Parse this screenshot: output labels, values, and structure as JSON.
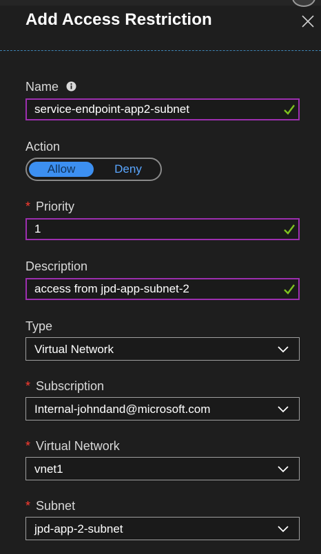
{
  "header": {
    "title": "Add Access Restriction"
  },
  "fields": {
    "name": {
      "label": "Name",
      "value": "service-endpoint-app2-subnet"
    },
    "action": {
      "label": "Action",
      "options": [
        "Allow",
        "Deny"
      ],
      "selected": "Allow"
    },
    "priority": {
      "label": "Priority",
      "required": true,
      "value": "1"
    },
    "description": {
      "label": "Description",
      "value": "access from jpd-app-subnet-2"
    },
    "type": {
      "label": "Type",
      "value": "Virtual Network"
    },
    "subscription": {
      "label": "Subscription",
      "required": true,
      "value": "Internal-johndand@microsoft.com"
    },
    "virtual_network": {
      "label": "Virtual Network",
      "required": true,
      "value": "vnet1"
    },
    "subnet": {
      "label": "Subnet",
      "required": true,
      "value": "jpd-app-2-subnet"
    }
  },
  "required_marker": "*",
  "icons": {
    "close": "close-icon",
    "info": "info-icon",
    "valid": "check-icon",
    "dropdown": "chevron-down-icon"
  },
  "colors": {
    "background": "#1e1e1e",
    "focus_border": "#9d2fb0",
    "valid_check": "#7dc21e",
    "toggle_active": "#3c8ff1",
    "required": "#ff3b30",
    "divider": "#3f86b7"
  }
}
